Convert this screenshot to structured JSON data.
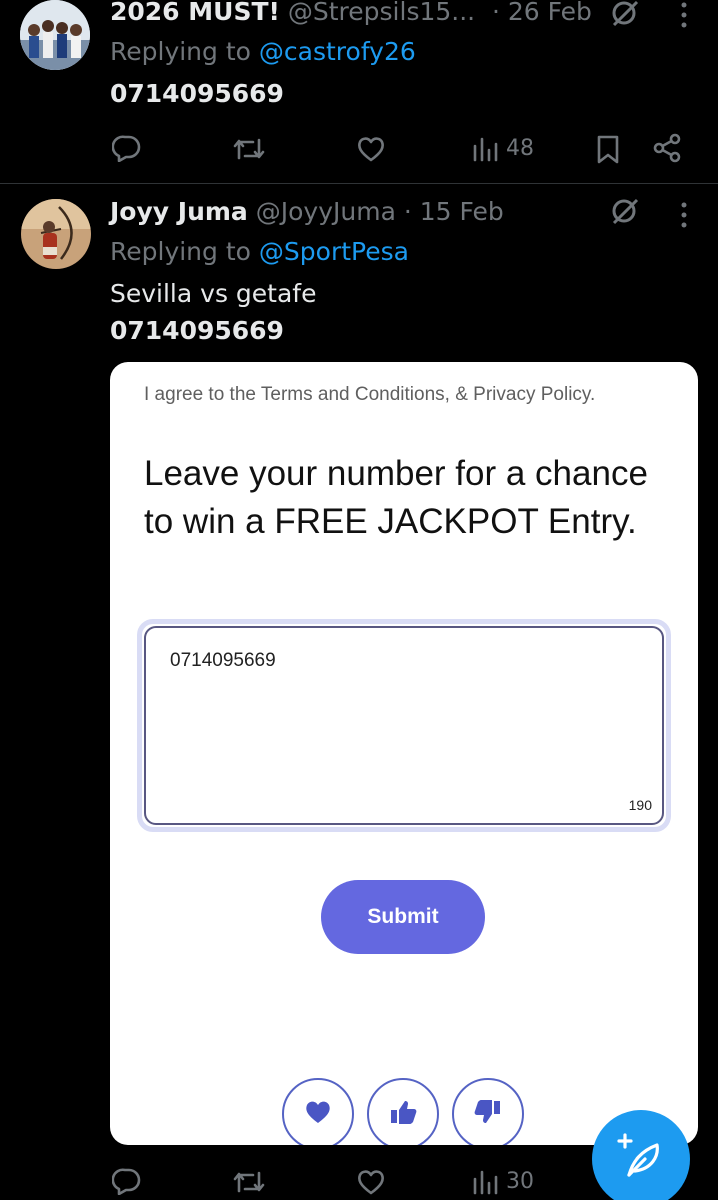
{
  "tweet1": {
    "display_name": "2026 MUST!",
    "handle": "@Strepsils15...",
    "date": "· 26 Feb",
    "reply_prefix": "Replying to",
    "reply_to": "@castrofy26",
    "text": "0714095669",
    "views": "48",
    "avatar_icon": "group-photo-avatar"
  },
  "tweet2": {
    "display_name": "Joyy Juma",
    "handle": "@JoyyJuma",
    "date": "· 15 Feb",
    "reply_prefix": "Replying to",
    "reply_to": "@SportPesa",
    "line1": "Sevilla vs getafe",
    "line2": "0714095669",
    "views": "30",
    "avatar_icon": "archer-avatar"
  },
  "card": {
    "terms": "I agree to the Terms and Conditions, & Privacy Policy.",
    "heading": "Leave your number for a chance to win a FREE JACKPOT Entry.",
    "input_value": "0714095669",
    "char_counter": "190",
    "submit_label": "Submit",
    "reactions": [
      "heart-icon",
      "thumbs-up-icon",
      "thumbs-down-icon"
    ]
  },
  "colors": {
    "background": "#000000",
    "text": "#e7e9ea",
    "muted": "#71767b",
    "link": "#1d9bf0",
    "submit": "#6468e0",
    "fab": "#1d9bf0"
  },
  "fab": {
    "icon": "compose-feather-icon"
  }
}
